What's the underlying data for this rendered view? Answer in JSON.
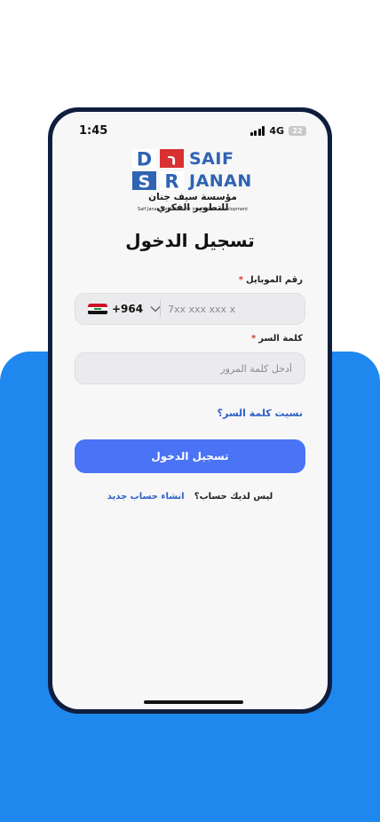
{
  "status_bar": {
    "time": "1:45",
    "network": "4G",
    "battery": "22"
  },
  "logo": {
    "letters": {
      "top_left": "D",
      "top_right": "ר",
      "bottom_left": "S",
      "bottom_right": "R"
    },
    "word_top": "SAIF",
    "word_bottom": "JANAN",
    "arabic_name": "مؤسسة سيف جنان للتطوير الفكري",
    "english_name": "Saif Janan institution for intellectual development"
  },
  "login": {
    "title": "تسجيل الدخول",
    "mobile_label": "رقم الموبايل",
    "required_mark": "*",
    "country_code": "+964",
    "mobile_placeholder": "7xx xxx xxx x",
    "password_label": "كلمة السر",
    "password_placeholder": "أدخل كلمة المرور",
    "forgot_password": "نسيت كلمة السر؟",
    "submit_label": "تسجيل الدخول",
    "no_account_text": "ليس لديك حساب؟",
    "create_account_link": "انشاء حساب جديد"
  },
  "colors": {
    "primary": "#4a73f6",
    "link": "#2d5fc9",
    "background_band": "#1e88ee",
    "device_frame": "#0f1d3e",
    "logo_blue": "#2f63b3",
    "logo_red": "#d93030",
    "required": "#e53935"
  },
  "icons": [
    "iraq-flag-icon",
    "chevron-down-icon",
    "signal-icon",
    "battery-icon"
  ]
}
